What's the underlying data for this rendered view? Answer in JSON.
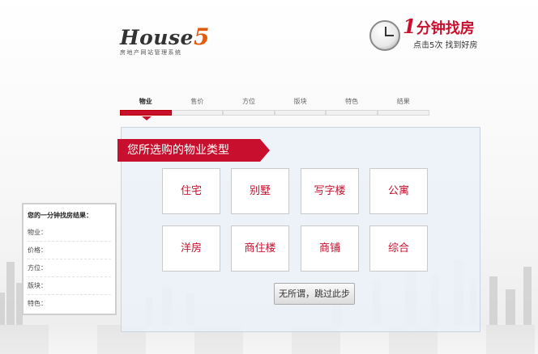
{
  "brand": {
    "logo_main": "House",
    "logo_num": "5",
    "logo_sub": "房地产网站管理系统"
  },
  "slogan": {
    "big_num": "1",
    "big_text": "分钟找房",
    "small": "点击5次  找到好房"
  },
  "steps": [
    {
      "label": "物业",
      "active": true
    },
    {
      "label": "售价",
      "active": false
    },
    {
      "label": "方位",
      "active": false
    },
    {
      "label": "版块",
      "active": false
    },
    {
      "label": "特色",
      "active": false
    },
    {
      "label": "结果",
      "active": false
    }
  ],
  "panel": {
    "title": "您所选购的物业类型",
    "options": [
      "住宅",
      "别墅",
      "写字楼",
      "公寓",
      "洋房",
      "商住楼",
      "商铺",
      "综合"
    ],
    "skip_label": "无所谓，跳过此步"
  },
  "result": {
    "title": "您的一分钟找房结果：",
    "rows": [
      "物业：",
      "价格：",
      "方位：",
      "版块：",
      "特色："
    ]
  },
  "colors": {
    "accent": "#c8102e",
    "panel_bg": "#ecf1f8"
  }
}
